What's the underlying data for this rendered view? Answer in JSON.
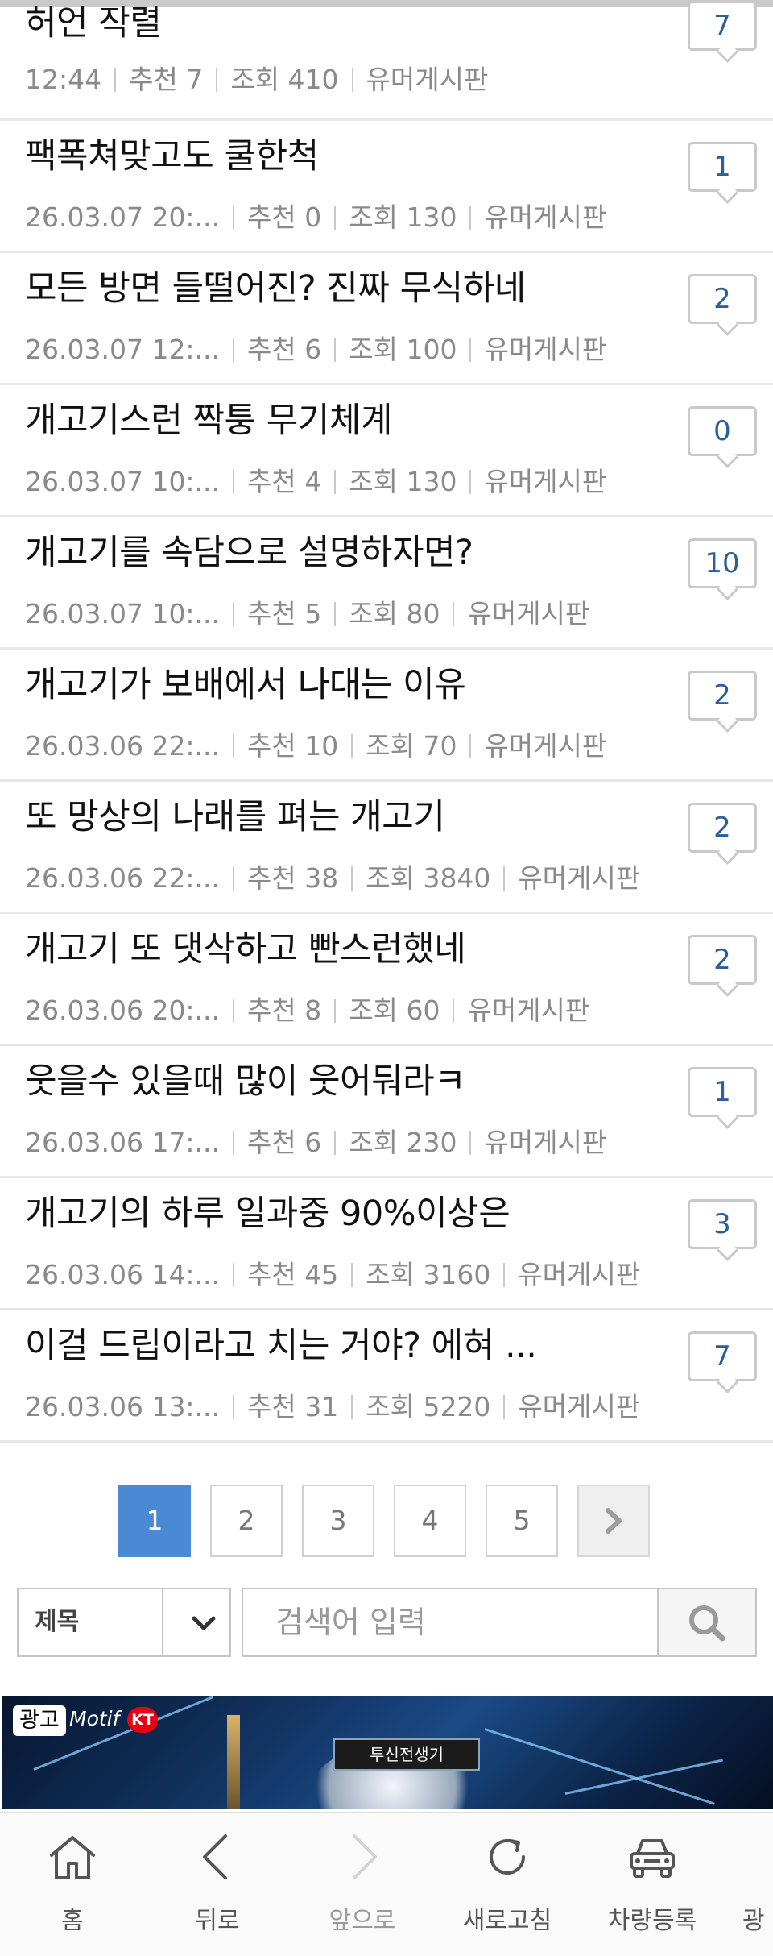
{
  "posts": [
    {
      "title": "허언 작렬",
      "date": "12:44",
      "recommend": "추천 7",
      "views": "조회 410",
      "board": "유머게시판",
      "comments": "7"
    },
    {
      "title": "팩폭쳐맞고도 쿨한척",
      "date": "26.03.07  20:...",
      "recommend": "추천 0",
      "views": "조회 130",
      "board": "유머게시판",
      "comments": "1"
    },
    {
      "title": "모든 방면 들떨어진? 진짜 무식하네",
      "date": "26.03.07  12:...",
      "recommend": "추천 6",
      "views": "조회 100",
      "board": "유머게시판",
      "comments": "2"
    },
    {
      "title": "개고기스런 짝퉁 무기체계",
      "date": "26.03.07  10:...",
      "recommend": "추천 4",
      "views": "조회 130",
      "board": "유머게시판",
      "comments": "0"
    },
    {
      "title": "개고기를 속담으로 설명하자면?",
      "date": "26.03.07  10:...",
      "recommend": "추천 5",
      "views": "조회 80",
      "board": "유머게시판",
      "comments": "10"
    },
    {
      "title": "개고기가 보배에서 나대는 이유",
      "date": "26.03.06  22:...",
      "recommend": "추천 10",
      "views": "조회 70",
      "board": "유머게시판",
      "comments": "2"
    },
    {
      "title": "또 망상의 나래를 펴는 개고기",
      "date": "26.03.06  22:...",
      "recommend": "추천 38",
      "views": "조회 3840",
      "board": "유머게시판",
      "comments": "2"
    },
    {
      "title": "개고기 또 댓삭하고 빤스런했네",
      "date": "26.03.06  20:...",
      "recommend": "추천 8",
      "views": "조회 60",
      "board": "유머게시판",
      "comments": "2"
    },
    {
      "title": "웃을수 있을때 많이 웃어둬라ㅋ",
      "date": "26.03.06  17:...",
      "recommend": "추천 6",
      "views": "조회 230",
      "board": "유머게시판",
      "comments": "1"
    },
    {
      "title": "개고기의 하루 일과중 90%이상은",
      "date": "26.03.06  14:...",
      "recommend": "추천 45",
      "views": "조회 3160",
      "board": "유머게시판",
      "comments": "3"
    },
    {
      "title": "이걸 드립이라고 치는 거야? 에혀 ...",
      "date": "26.03.06  13:...",
      "recommend": "추천 31",
      "views": "조회 5220",
      "board": "유머게시판",
      "comments": "7"
    }
  ],
  "pagination": {
    "pages": [
      "1",
      "2",
      "3",
      "4",
      "5"
    ],
    "current": "1",
    "next_icon": "chevron-right-icon"
  },
  "search": {
    "field_label": "제목",
    "placeholder": "검색어 입력",
    "dropdown_icon": "chevron-down-icon",
    "button_icon": "search-icon"
  },
  "ad": {
    "badge": "광고",
    "brand": "Motif",
    "partner": "KT",
    "game_title": "투신전생기"
  },
  "bottom_nav": {
    "items": [
      {
        "label": "홈",
        "icon": "home-icon"
      },
      {
        "label": "뒤로",
        "icon": "back-icon"
      },
      {
        "label": "앞으로",
        "icon": "forward-icon"
      },
      {
        "label": "새로고침",
        "icon": "refresh-icon"
      },
      {
        "label": "차량등록",
        "icon": "car-icon"
      },
      {
        "label": "광",
        "icon": ""
      }
    ]
  },
  "colors": {
    "accent": "#4a89d4",
    "comment_count": "#2c5f9a",
    "meta_text": "#8a8a8a"
  }
}
